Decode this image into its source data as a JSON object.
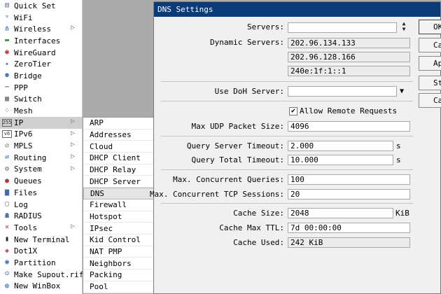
{
  "sidebar": {
    "items": [
      {
        "label": "Quick Set",
        "icon": "quick-set-icon",
        "glyph": "▤",
        "color": "#6b7fa8",
        "arrow": false
      },
      {
        "label": "WiFi",
        "icon": "wifi-icon",
        "glyph": "⌔",
        "color": "#4a7dc0",
        "arrow": false
      },
      {
        "label": "Wireless",
        "icon": "wireless-icon",
        "glyph": "⋔",
        "color": "#3a70c0",
        "arrow": true
      },
      {
        "label": "Interfaces",
        "icon": "interfaces-icon",
        "glyph": "▬",
        "color": "#3f9a3f",
        "arrow": false
      },
      {
        "label": "WireGuard",
        "icon": "wireguard-icon",
        "glyph": "◉",
        "color": "#b03030",
        "arrow": false
      },
      {
        "label": "ZeroTier",
        "icon": "zerotier-icon",
        "glyph": "✦",
        "color": "#2a6fc0",
        "arrow": false
      },
      {
        "label": "Bridge",
        "icon": "bridge-icon",
        "glyph": "⚉",
        "color": "#3b6fb2",
        "arrow": false
      },
      {
        "label": "PPP",
        "icon": "ppp-icon",
        "glyph": "⋯",
        "color": "#555555",
        "arrow": false
      },
      {
        "label": "Switch",
        "icon": "switch-icon",
        "glyph": "▦",
        "color": "#666666",
        "arrow": false
      },
      {
        "label": "Mesh",
        "icon": "mesh-icon",
        "glyph": "⁘",
        "color": "#555555",
        "arrow": false
      },
      {
        "label": "IP",
        "icon": "ip-icon",
        "glyph": "255",
        "color": "#333333",
        "arrow": true
      },
      {
        "label": "IPv6",
        "icon": "ipv6-icon",
        "glyph": "v6",
        "color": "#333333",
        "arrow": true
      },
      {
        "label": "MPLS",
        "icon": "mpls-icon",
        "glyph": "⊘",
        "color": "#777777",
        "arrow": true
      },
      {
        "label": "Routing",
        "icon": "routing-icon",
        "glyph": "⇄",
        "color": "#3a6fb0",
        "arrow": true
      },
      {
        "label": "System",
        "icon": "system-icon",
        "glyph": "⚙",
        "color": "#666666",
        "arrow": true
      },
      {
        "label": "Queues",
        "icon": "queues-icon",
        "glyph": "●",
        "color": "#b53b3b",
        "arrow": false
      },
      {
        "label": "Files",
        "icon": "files-icon",
        "glyph": "▆",
        "color": "#3b6db0",
        "arrow": false
      },
      {
        "label": "Log",
        "icon": "log-icon",
        "glyph": "▢",
        "color": "#777777",
        "arrow": false
      },
      {
        "label": "RADIUS",
        "icon": "radius-icon",
        "glyph": "☗",
        "color": "#5575a8",
        "arrow": false
      },
      {
        "label": "Tools",
        "icon": "tools-icon",
        "glyph": "✕",
        "color": "#b03030",
        "arrow": true
      },
      {
        "label": "New Terminal",
        "icon": "terminal-icon",
        "glyph": "▮",
        "color": "#222222",
        "arrow": false
      },
      {
        "label": "Dot1X",
        "icon": "dot1x-icon",
        "glyph": "◈",
        "color": "#b03030",
        "arrow": false
      },
      {
        "label": "Partition",
        "icon": "partition-icon",
        "glyph": "◉",
        "color": "#3a6fb0",
        "arrow": false
      },
      {
        "label": "Make Supout.rif",
        "icon": "supout-icon",
        "glyph": "☺",
        "color": "#3a6fb0",
        "arrow": false
      },
      {
        "label": "New WinBox",
        "icon": "winbox-icon",
        "glyph": "◍",
        "color": "#2f6fb8",
        "arrow": false
      }
    ]
  },
  "submenu": {
    "items": [
      "ARP",
      "Addresses",
      "Cloud",
      "DHCP Client",
      "DHCP Relay",
      "DHCP Server",
      "DNS",
      "Firewall",
      "Hotspot",
      "IPsec",
      "Kid Control",
      "NAT PMP",
      "Neighbors",
      "Packing",
      "Pool"
    ],
    "selected": "DNS"
  },
  "window": {
    "title": "DNS Settings",
    "servers_label": "Servers:",
    "servers_value": "",
    "dynamic_servers_label": "Dynamic Servers:",
    "dynamic_servers": [
      "202.96.134.133",
      "202.96.128.166",
      "240e:1f:1::1"
    ],
    "doh_label": "Use DoH Server:",
    "doh_value": "",
    "allow_remote_label": "Allow Remote Requests",
    "allow_remote_checked": true,
    "max_udp_label": "Max UDP Packet Size:",
    "max_udp_value": "4096",
    "query_server_timeout_label": "Query Server Timeout:",
    "query_server_timeout_value": "2.000",
    "query_server_timeout_unit": "s",
    "query_total_timeout_label": "Query Total Timeout:",
    "query_total_timeout_value": "10.000",
    "query_total_timeout_unit": "s",
    "max_concurrent_queries_label": "Max. Concurrent Queries:",
    "max_concurrent_queries_value": "100",
    "max_concurrent_tcp_label": "Max. Concurrent TCP Sessions:",
    "max_concurrent_tcp_value": "20",
    "cache_size_label": "Cache Size:",
    "cache_size_value": "2048",
    "cache_size_unit": "KiB",
    "cache_max_ttl_label": "Cache Max TTL:",
    "cache_max_ttl_value": "7d 00:00:00",
    "cache_used_label": "Cache Used:",
    "cache_used_value": "242 KiB",
    "buttons": [
      "OK",
      "Cancel",
      "Apply",
      "Static",
      "Cache"
    ]
  }
}
